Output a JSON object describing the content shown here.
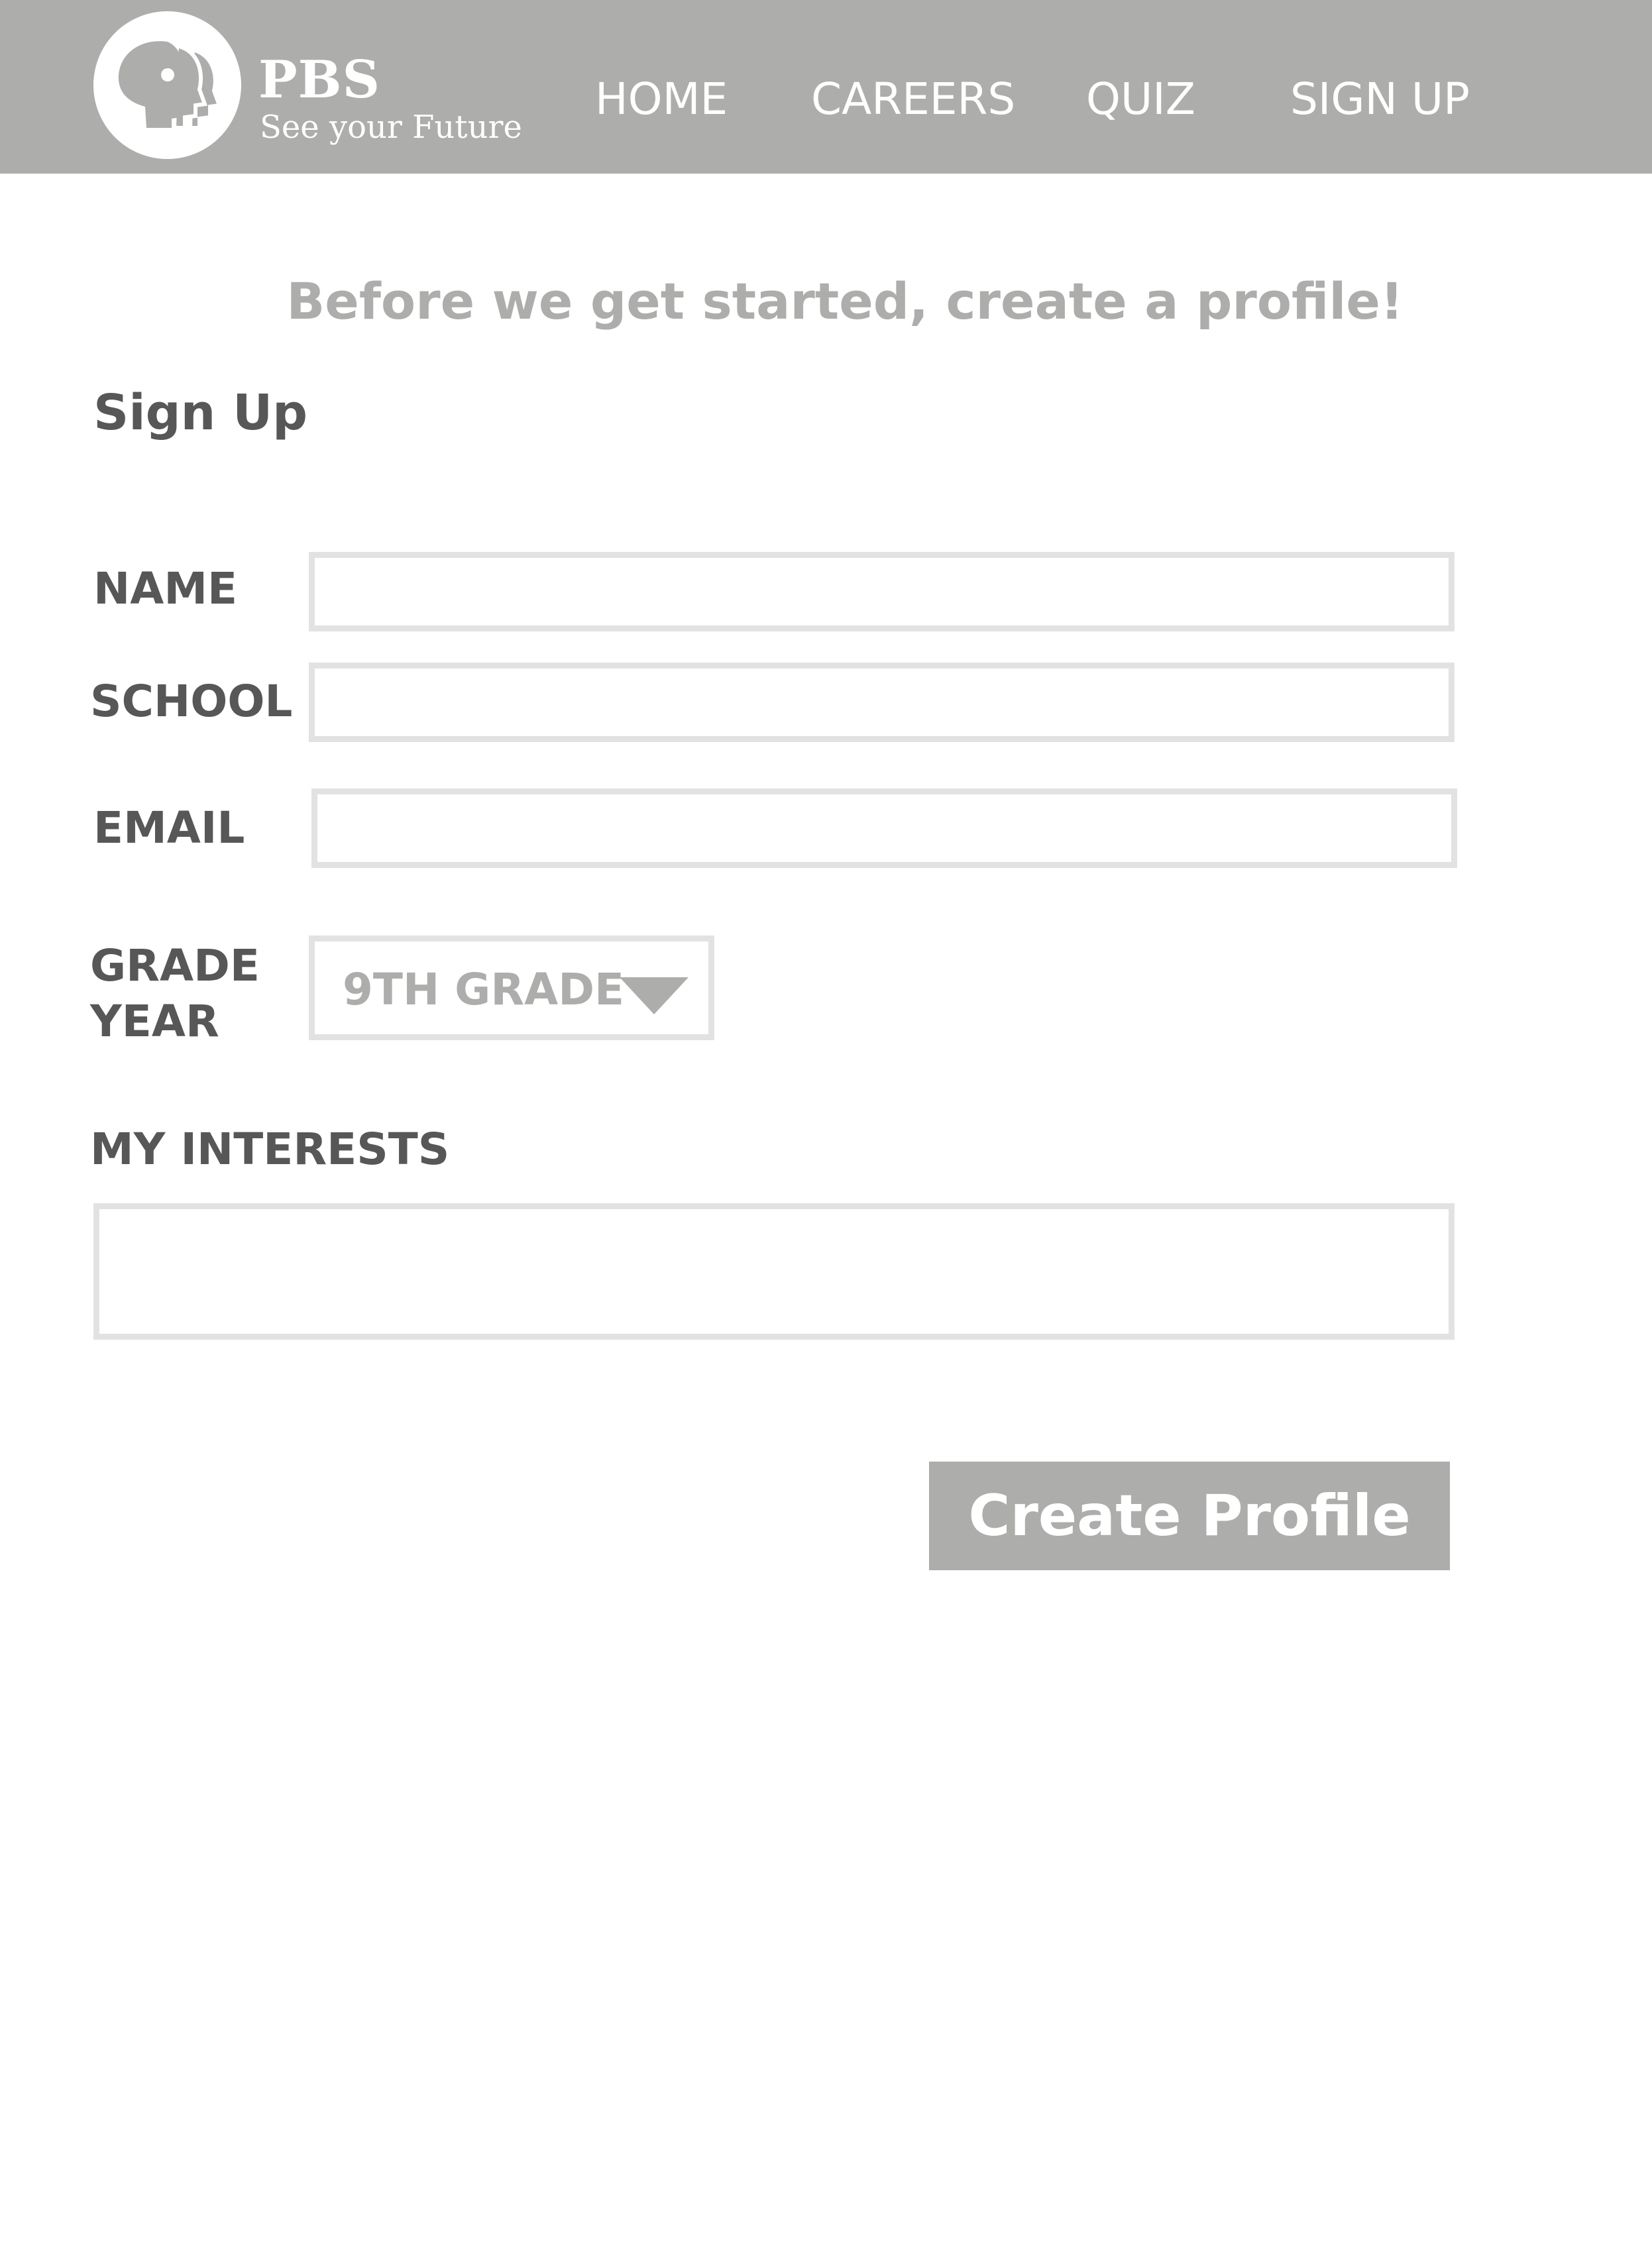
{
  "header": {
    "brand_name": "PBS",
    "tagline": "See your Future",
    "logo_icon": "pbs-heads-logo-icon",
    "nav": {
      "home": "HOME",
      "careers": "CAREERS",
      "quiz": "QUIZ",
      "sign_up": "SIGN UP"
    }
  },
  "intro_text": "Before we get started, create a profile!",
  "page_title": "Sign Up",
  "form": {
    "name_label": "NAME",
    "name_value": "",
    "school_label": "SCHOOL",
    "school_value": "",
    "email_label": "EMAIL",
    "email_value": "",
    "grade_label_line1": "GRADE",
    "grade_label_line2": "YEAR",
    "grade_selected": "9TH GRADE",
    "interests_label": "MY INTERESTS",
    "interests_value": "",
    "submit_label": "Create Profile"
  },
  "colors": {
    "header_bg": "#adadac",
    "label_text": "#575757",
    "muted_text": "#adadac",
    "field_border": "#e2e2e2",
    "button_bg": "#adadac",
    "button_text": "#ffffff"
  }
}
